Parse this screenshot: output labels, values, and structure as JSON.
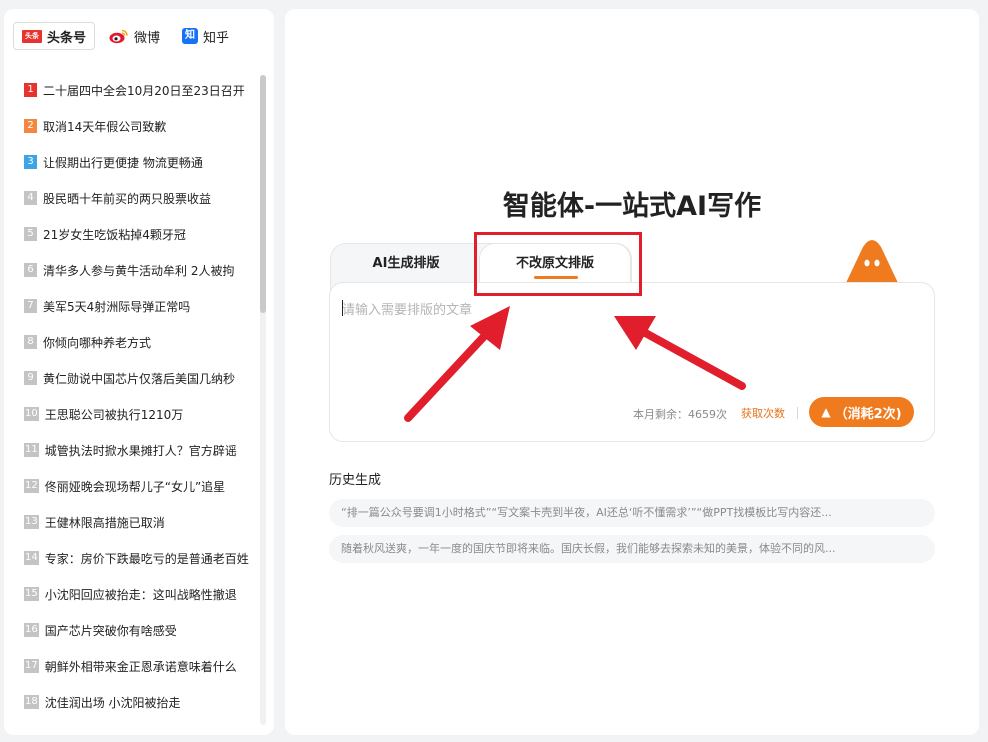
{
  "sources": {
    "tabs": [
      {
        "label": "头条号",
        "logo_text": "头条",
        "icon": "toutiao-logo-icon"
      },
      {
        "label": "微博",
        "icon": "weibo-logo-icon"
      },
      {
        "label": "知乎",
        "logo_text": "知",
        "icon": "zhihu-logo-icon"
      }
    ],
    "active": "头条号"
  },
  "hot_list": [
    {
      "rank": "1",
      "title": "二十届四中全会10月20日至23日召开"
    },
    {
      "rank": "2",
      "title": "取消14天年假公司致歉"
    },
    {
      "rank": "3",
      "title": "让假期出行更便捷 物流更畅通"
    },
    {
      "rank": "4",
      "title": "股民晒十年前买的两只股票收益"
    },
    {
      "rank": "5",
      "title": "21岁女生吃饭粘掉4颗牙冠"
    },
    {
      "rank": "6",
      "title": "清华多人参与黄牛活动牟利 2人被拘"
    },
    {
      "rank": "7",
      "title": "美军5天4射洲际导弹正常吗"
    },
    {
      "rank": "8",
      "title": "你倾向哪种养老方式"
    },
    {
      "rank": "9",
      "title": "黄仁勋说中国芯片仅落后美国几纳秒"
    },
    {
      "rank": "10",
      "title": "王思聪公司被执行1210万"
    },
    {
      "rank": "11",
      "title": "城管执法时掀水果摊打人？官方辟谣"
    },
    {
      "rank": "12",
      "title": "佟丽娅晚会现场帮儿子“女儿”追星"
    },
    {
      "rank": "13",
      "title": "王健林限高措施已取消"
    },
    {
      "rank": "14",
      "title": "专家：房价下跌最吃亏的是普通老百姓"
    },
    {
      "rank": "15",
      "title": "小沈阳回应被抬走：这叫战略性撤退"
    },
    {
      "rank": "16",
      "title": "国产芯片突破你有啥感受"
    },
    {
      "rank": "17",
      "title": "朝鲜外相带来金正恩承诺意味着什么"
    },
    {
      "rank": "18",
      "title": "沈佳润出场 小沈阳被抬走"
    }
  ],
  "main": {
    "title": "智能体-一站式AI写作",
    "tabs": [
      {
        "label": "AI生成排版"
      },
      {
        "label": "不改原文排版"
      }
    ],
    "active_tab": "不改原文排版",
    "editor": {
      "placeholder": "请输入需要排版的文章",
      "value": ""
    },
    "quota_text": "本月剩余：4659次",
    "get_more_label": "获取次数",
    "submit_label": "（消耗2次)",
    "history_title": "历史生成",
    "history": [
      "“排一篇公众号要调1小时格式”“写文案卡壳到半夜，AI还总‘听不懂需求’”“做PPT找模板比写内容还...",
      "随着秋风送爽，一年一度的国庆节即将来临。国庆长假，我们能够去探索未知的美景，体验不同的风..."
    ]
  },
  "colors": {
    "accent": "#f07b1f",
    "annotation": "#e01e2c",
    "rank1": "#e8322d",
    "rank2": "#f4863f",
    "rank3": "#3ba5e6"
  }
}
